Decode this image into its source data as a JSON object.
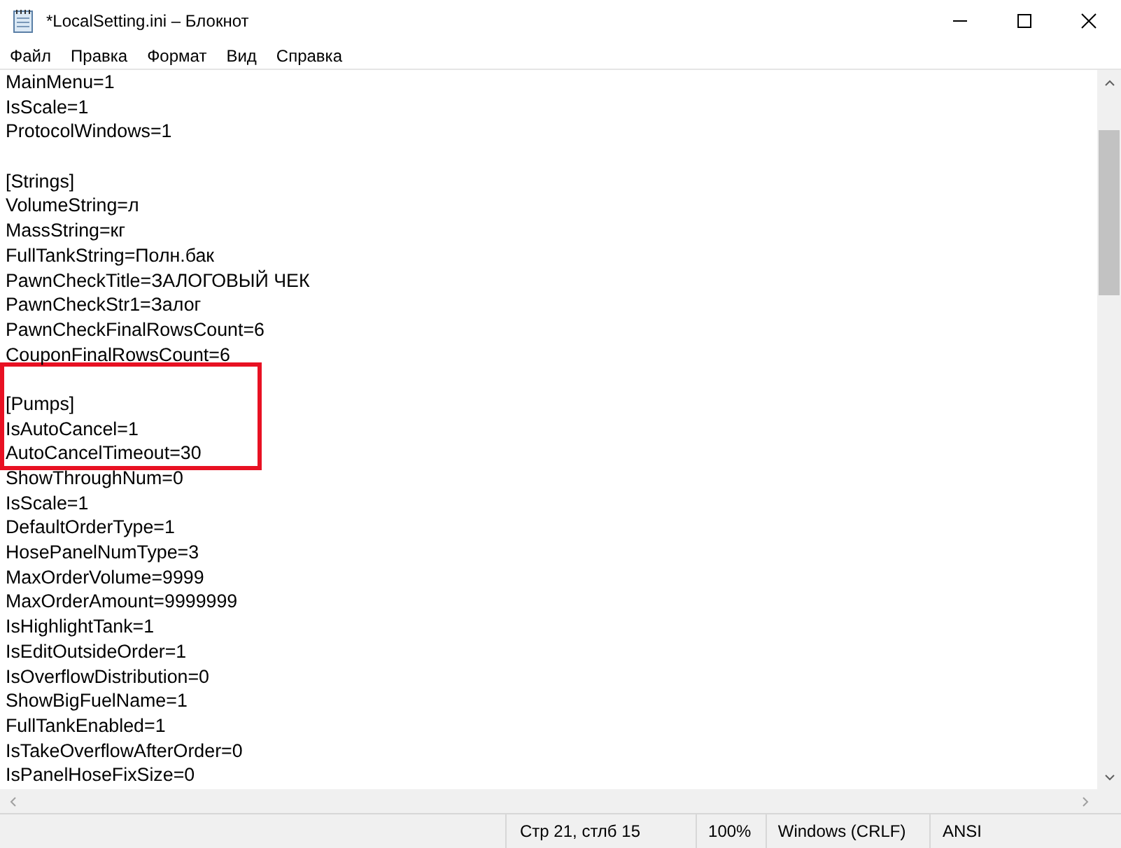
{
  "window": {
    "title": "*LocalSetting.ini – Блокнот"
  },
  "menu": [
    "Файл",
    "Правка",
    "Формат",
    "Вид",
    "Справка"
  ],
  "editor": {
    "lines": [
      {
        "kind": "text",
        "text": "MainMenu=1",
        "highlighted": false
      },
      {
        "kind": "text",
        "text": "IsScale=1",
        "highlighted": false
      },
      {
        "kind": "text",
        "text": "ProtocolWindows=1",
        "highlighted": false
      },
      {
        "kind": "blank",
        "highlighted": false
      },
      {
        "kind": "text",
        "text": "[Strings]",
        "highlighted": false
      },
      {
        "kind": "text",
        "text": "VolumeString=л",
        "highlighted": false
      },
      {
        "kind": "text",
        "text": "MassString=кг",
        "highlighted": false
      },
      {
        "kind": "text",
        "text": "FullTankString=Полн.бак",
        "highlighted": false
      },
      {
        "kind": "text",
        "text": "PawnCheckTitle=ЗАЛОГОВЫЙ ЧЕК",
        "highlighted": false
      },
      {
        "kind": "text",
        "text": "PawnCheckStr1=Залог",
        "highlighted": false
      },
      {
        "kind": "text",
        "text": "PawnCheckFinalRowsCount=6",
        "highlighted": false
      },
      {
        "kind": "text",
        "text": "CouponFinalRowsCount=6",
        "highlighted": false
      },
      {
        "kind": "blank",
        "highlighted": true
      },
      {
        "kind": "text",
        "text": "[Pumps]",
        "highlighted": true
      },
      {
        "kind": "text",
        "text": "IsAutoCancel=1",
        "highlighted": true
      },
      {
        "kind": "text",
        "text": "AutoCancelTimeout=30",
        "highlighted": true
      },
      {
        "kind": "text",
        "text": "ShowThroughNum=0",
        "highlighted": false
      },
      {
        "kind": "text",
        "text": "IsScale=1",
        "highlighted": false
      },
      {
        "kind": "text",
        "text": "DefaultOrderType=1",
        "highlighted": false
      },
      {
        "kind": "text",
        "text": "HosePanelNumType=3",
        "highlighted": false
      },
      {
        "kind": "text",
        "text": "MaxOrderVolume=9999",
        "highlighted": false
      },
      {
        "kind": "text",
        "text": "MaxOrderAmount=9999999",
        "highlighted": false
      },
      {
        "kind": "text",
        "text": "IsHighlightTank=1",
        "highlighted": false
      },
      {
        "kind": "text",
        "text": "IsEditOutsideOrder=1",
        "highlighted": false
      },
      {
        "kind": "text",
        "text": "IsOverflowDistribution=0",
        "highlighted": false
      },
      {
        "kind": "text",
        "text": "ShowBigFuelName=1",
        "highlighted": false
      },
      {
        "kind": "text",
        "text": "FullTankEnabled=1",
        "highlighted": false
      },
      {
        "kind": "text",
        "text": "IsTakeOverflowAfterOrder=0",
        "highlighted": false
      },
      {
        "kind": "text",
        "text": "IsPanelHoseFixSize=0",
        "highlighted": false
      }
    ]
  },
  "status_bar": [
    "Стр 21, стлб 15",
    "100%",
    "Windows (CRLF)",
    "ANSI"
  ]
}
